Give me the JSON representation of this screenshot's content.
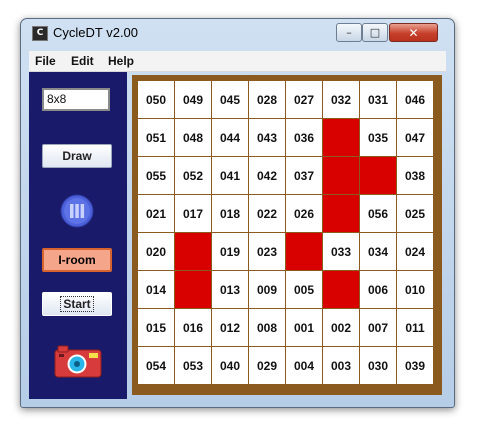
{
  "window": {
    "title": "CycleDT v2.00",
    "icon_glyph": "C"
  },
  "menu": {
    "items": [
      "File",
      "Edit",
      "Help"
    ]
  },
  "controls": {
    "size_value": "8x8",
    "draw_label": "Draw",
    "iroom_label": "I-room",
    "start_label": "Start"
  },
  "board": {
    "rows": [
      [
        "050",
        "049",
        "045",
        "028",
        "027",
        "032",
        "031",
        "046"
      ],
      [
        "051",
        "048",
        "044",
        "043",
        "036",
        "",
        "035",
        "047"
      ],
      [
        "055",
        "052",
        "041",
        "042",
        "037",
        "",
        "",
        "038"
      ],
      [
        "021",
        "017",
        "018",
        "022",
        "026",
        "",
        "056",
        "025"
      ],
      [
        "020",
        "",
        "019",
        "023",
        "",
        "033",
        "034",
        "024"
      ],
      [
        "014",
        "",
        "013",
        "009",
        "005",
        "",
        "006",
        "010"
      ],
      [
        "015",
        "016",
        "012",
        "008",
        "001",
        "002",
        "007",
        "011"
      ],
      [
        "054",
        "053",
        "040",
        "029",
        "004",
        "003",
        "030",
        "039"
      ]
    ]
  },
  "colors": {
    "panel": "#1a1a6a",
    "board_border": "#8a5a1e",
    "blocked": "#d90000",
    "iroom": "#f5a58a"
  }
}
